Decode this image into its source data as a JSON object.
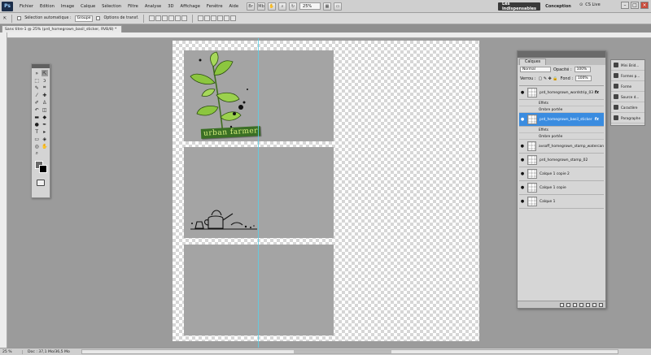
{
  "app": {
    "logo": "Ps",
    "menu": [
      "Fichier",
      "Edition",
      "Image",
      "Calque",
      "Sélection",
      "Filtre",
      "Analyse",
      "3D",
      "Affichage",
      "Fenêtre",
      "Aide"
    ],
    "zoom": "25%",
    "workspaces": {
      "active": "Les indispensables",
      "other": "Conception"
    },
    "cs_live": "CS Live"
  },
  "options_bar": {
    "auto_select_label": "Sélection automatique :",
    "auto_select_value": "Groupe",
    "transform_label": "Options de transf."
  },
  "document": {
    "tab_title": "Sans titre-1 @ 25% (prd_homegrown_basil_sticker, RVB/8) *",
    "sticker_text": "urban farmer"
  },
  "layers_panel": {
    "tab": "Calques",
    "blend_mode": "Normal",
    "opacity_label": "Opacité :",
    "opacity_value": "100%",
    "lock_label": "Verrou :",
    "fill_label": "Fond :",
    "fill_value": "100%",
    "layers": [
      {
        "name": "prd_homegrown_wordstrip_03",
        "fx": "fx",
        "effects_label": "Effets",
        "effect": "Ombre portée",
        "selected": false
      },
      {
        "name": "prd_homegrown_basil_sticker",
        "fx": "fx",
        "effects_label": "Effets",
        "effect": "Ombre portée",
        "selected": true
      },
      {
        "name": "avsoff_homegrown_stamp_watercan",
        "selected": false
      },
      {
        "name": "prd_homegrown_stamp_02",
        "selected": false
      },
      {
        "name": "Calque 1 copie 2",
        "selected": false
      },
      {
        "name": "Calque 1 copie",
        "selected": false
      },
      {
        "name": "Calque 1",
        "selected": false
      }
    ]
  },
  "mini_panel": {
    "items": [
      "Mini Brid...",
      "Formes p...",
      "Forme",
      "Source d...",
      "Caractère",
      "Paragraphe"
    ]
  },
  "status_bar": {
    "zoom": "25 %",
    "doc_info": "Doc : 37,1 Mo/36,5 Mo"
  },
  "colors": {
    "selection_blue": "#3a8ce0",
    "guide_cyan": "#5bd0e8",
    "leaf_green": "#8cc63f",
    "sticker_dark_green": "#3a6f24"
  }
}
